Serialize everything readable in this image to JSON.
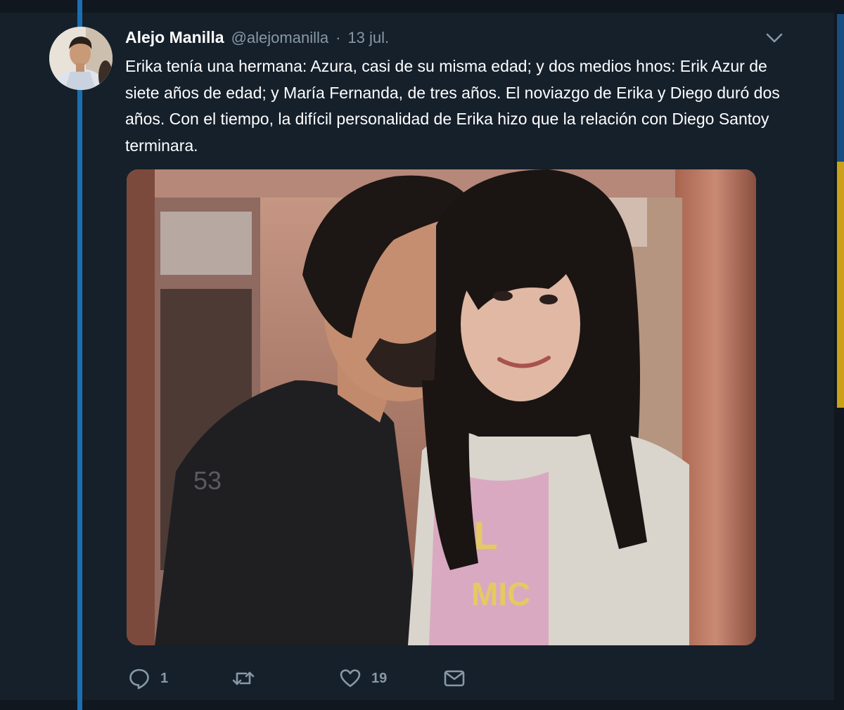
{
  "tweet": {
    "author_name": "Alejo Manilla",
    "author_handle": "@alejomanilla",
    "separator": "·",
    "date": "13 jul.",
    "text": "Erika tenía una hermana: Azura, casi de su misma edad; y dos medios hnos: Erik Azur de siete años de edad; y María Fernanda, de tres años. El noviazgo de Erika y Diego duró dos años. Con el tiempo, la difícil personalidad de Erika hizo que la relación con Diego Santoy terminara.",
    "media_icon": "photo-of-couple"
  },
  "actions": {
    "reply": {
      "icon": "reply-icon",
      "count": "1"
    },
    "retweet": {
      "icon": "retweet-icon",
      "count": ""
    },
    "like": {
      "icon": "heart-icon",
      "count": "19"
    },
    "message": {
      "icon": "envelope-icon"
    }
  },
  "colors": {
    "background": "#15202b",
    "thread_line": "#1b6fb0",
    "secondary_text": "#8899a6"
  }
}
